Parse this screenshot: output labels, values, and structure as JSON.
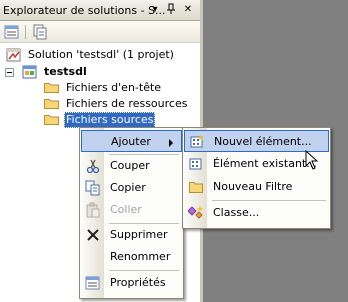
{
  "panel": {
    "title": "Explorateur de solutions - S...",
    "buttons": {
      "dropdown": "▾",
      "pin": "⊥",
      "close": "✕"
    }
  },
  "toolbar": {
    "items": [
      "properties-icon",
      "show-all-files-icon"
    ]
  },
  "tree": {
    "solution_label": "Solution 'testsdl' (1 projet)",
    "project_label": "testsdl",
    "folders": [
      {
        "label": "Fichiers d'en-tête"
      },
      {
        "label": "Fichiers de ressources"
      },
      {
        "label": "Fichiers sources"
      }
    ]
  },
  "context_menu": {
    "items": [
      {
        "label": "Ajouter",
        "icon": "none",
        "submenu": true
      },
      {
        "label": "Couper",
        "icon": "scissors-icon"
      },
      {
        "label": "Copier",
        "icon": "copy-icon"
      },
      {
        "label": "Coller",
        "icon": "paste-icon",
        "disabled": true
      },
      {
        "label": "Supprimer",
        "icon": "delete-icon"
      },
      {
        "label": "Renommer",
        "icon": "none"
      },
      {
        "label": "Propriétés",
        "icon": "properties-icon"
      }
    ]
  },
  "submenu": {
    "items": [
      {
        "label": "Nouvel élément...",
        "icon": "new-item-icon"
      },
      {
        "label": "Élément existant...",
        "icon": "existing-item-icon"
      },
      {
        "label": "Nouveau Filtre",
        "icon": "folder-icon"
      },
      {
        "label": "Classe...",
        "icon": "class-icon"
      }
    ]
  },
  "colors": {
    "selection": "#316ac5",
    "menu_hover": "#c1d2ee",
    "editor_bg": "#808080"
  }
}
